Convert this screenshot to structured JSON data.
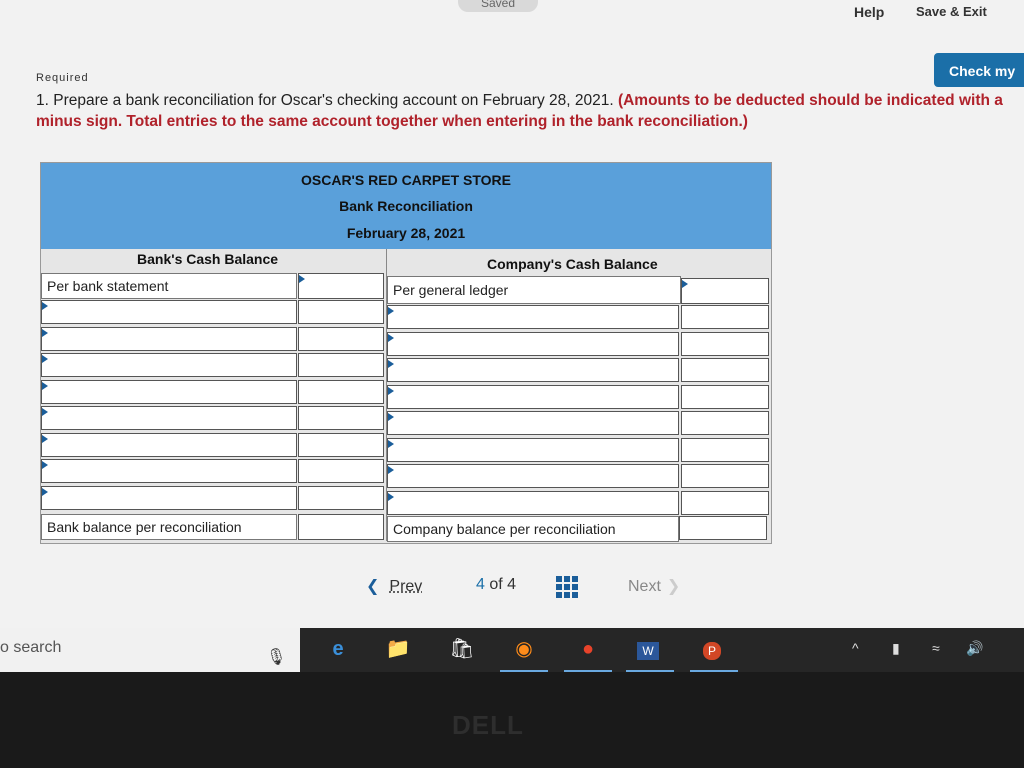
{
  "header": {
    "saved_label": "Saved",
    "help_label": "Help",
    "save_exit_label": "Save & Exit",
    "check_button_label": "Check my"
  },
  "question": {
    "requirement_label": "Required",
    "text": "1. Prepare a bank reconciliation for Oscar's checking account on February 28, 2021.",
    "emphasis": "(Amounts to be deducted should be indicated with a minus sign. Total entries to the same account together when entering in the bank reconciliation.)"
  },
  "reconciliation": {
    "company": "OSCAR'S RED CARPET STORE",
    "title": "Bank Reconciliation",
    "date": "February 28, 2021",
    "bank_heading": "Bank's Cash Balance",
    "company_heading": "Company's Cash Balance",
    "bank_first_row": "Per bank statement",
    "company_first_row": "Per general ledger",
    "bank_total_row": "Bank balance per reconciliation",
    "company_total_row": "Company balance per reconciliation"
  },
  "pager": {
    "prev_label": "Prev",
    "current": "4",
    "of_label": "of",
    "total": "4",
    "next_label": "Next"
  },
  "taskbar": {
    "search_placeholder": "o search",
    "apps": [
      "edge-icon",
      "file-explorer-icon",
      "store-icon",
      "firefox-icon",
      "cast-icon",
      "word-icon",
      "powerpoint-icon"
    ]
  },
  "brand": {
    "monitor_logo": "DELL"
  }
}
